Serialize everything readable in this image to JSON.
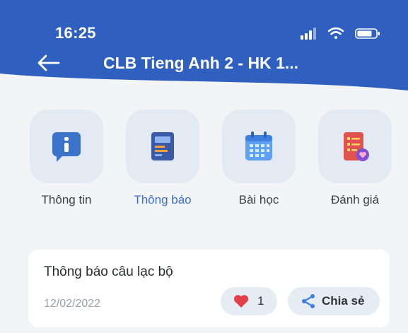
{
  "status": {
    "time": "16:25"
  },
  "header": {
    "title": "CLB Tieng Anh 2 - HK 1..."
  },
  "tiles": [
    {
      "label": "Thông tin",
      "icon": "info-icon",
      "active": false
    },
    {
      "label": "Thông báo",
      "icon": "announcement-icon",
      "active": true
    },
    {
      "label": "Bài học",
      "icon": "calendar-icon",
      "active": false
    },
    {
      "label": "Đánh giá",
      "icon": "evaluation-icon",
      "active": false
    }
  ],
  "post": {
    "title": "Thông báo câu lạc bộ",
    "date": "12/02/2022",
    "likes": "1",
    "share_label": "Chia sẻ"
  },
  "colors": {
    "header_bg": "#2f5fbf",
    "accent": "#3d6ec7",
    "tile_bg": "#e3eaf3",
    "heart": "#e5404a"
  }
}
